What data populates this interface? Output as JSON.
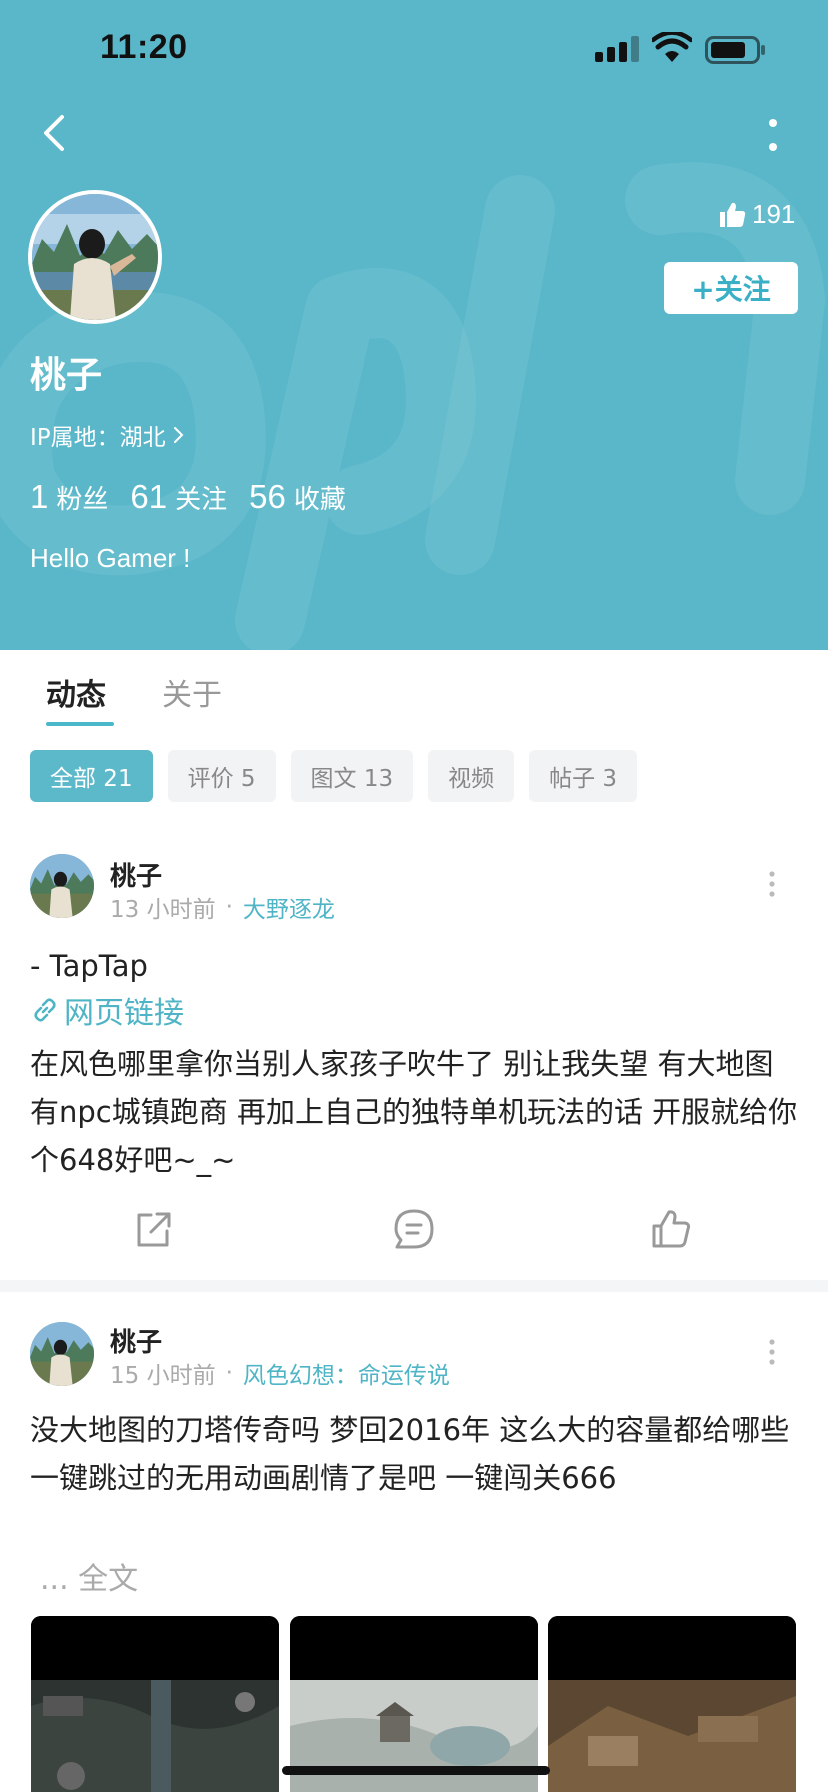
{
  "status_bar": {
    "time": "11:20"
  },
  "profile": {
    "likes": "191",
    "follow_label": "+关注",
    "name": "桃子",
    "ip_prefix": "IP属地：",
    "ip_location": "湖北",
    "stats": [
      {
        "num": "1",
        "label": "粉丝"
      },
      {
        "num": "61",
        "label": "关注"
      },
      {
        "num": "56",
        "label": "收藏"
      }
    ],
    "bio": "Hello Gamer !"
  },
  "tabs": [
    {
      "label": "动态",
      "active": true
    },
    {
      "label": "关于",
      "active": false
    }
  ],
  "filters": [
    {
      "label": "全部 21",
      "active": true
    },
    {
      "label": "评价 5",
      "active": false
    },
    {
      "label": "图文 13",
      "active": false
    },
    {
      "label": "视频",
      "active": false
    },
    {
      "label": "帖子 3",
      "active": false
    }
  ],
  "posts": [
    {
      "author": "桃子",
      "time": "13 小时前",
      "separator": "·",
      "game": "大野逐龙",
      "text": "- TapTap",
      "link_label": "网页链接",
      "body": "在风色哪里拿你当别人家孩子吹牛了 别让我失望 有大地图 有npc城镇跑商 再加上自己的独特单机玩法的话 开服就给你个648好吧~_~"
    },
    {
      "author": "桃子",
      "time": "15 小时前",
      "separator": "·",
      "game": "风色幻想：命运传说",
      "body": "没大地图的刀塔传奇吗 梦回2016年 这么大的容量都给哪些一键跳过的无用动画剧情了是吧 一键闯关666",
      "more": "... 全文"
    }
  ],
  "colors": {
    "header_bg": "#5ab7c9",
    "accent": "#4fb5c6",
    "chip_inactive_bg": "#f2f3f4"
  },
  "icons": {
    "back": "chevron-left-icon",
    "more": "vertical-dots-icon",
    "like": "thumbs-up-icon",
    "share": "share-icon",
    "comment": "comment-icon",
    "link": "link-icon"
  }
}
